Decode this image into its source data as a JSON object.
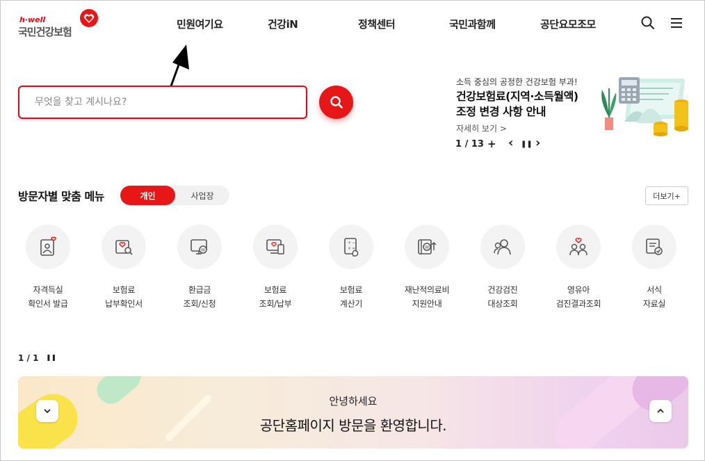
{
  "header": {
    "logo_small": "h·well",
    "logo_name": "국민건강보험",
    "nav": [
      "민원여기요",
      "건강iN",
      "정책센터",
      "국민과함께",
      "공단요모조모"
    ]
  },
  "search": {
    "placeholder": "무엇을 찾고 계시나요?"
  },
  "banner": {
    "subtitle": "소득 중심의 공정한 건강보험 부과!",
    "title_line1": "건강보험료(지역·소득월액)",
    "title_line2": "조정 변경 사항 안내",
    "more": "자세히 보기 >",
    "pager": "1 / 13",
    "plus": "+",
    "prev": "‹",
    "pause": "❚❚",
    "next": "›"
  },
  "menu": {
    "title": "방문자별 맞춤 메뉴",
    "tab_on": "개인",
    "tab_off": "사업장",
    "more": "더보기+",
    "items": [
      {
        "label": "자격득실\n확인서 발급",
        "icon": "certificate-heart-icon"
      },
      {
        "label": "보험료\n납부확인서",
        "icon": "document-search-icon"
      },
      {
        "label": "환급금\n조회/신청",
        "icon": "monitor-coin-icon"
      },
      {
        "label": "보험료\n조회/납부",
        "icon": "computer-receipt-icon"
      },
      {
        "label": "보험료\n계산기",
        "icon": "calculator-icon"
      },
      {
        "label": "재난적의료비\n지원안내",
        "icon": "wallet-coin-icon"
      },
      {
        "label": "건강검진\n대상조회",
        "icon": "people-search-icon"
      },
      {
        "label": "영유아\n검진결과조회",
        "icon": "family-heart-icon"
      },
      {
        "label": "서식\n자료실",
        "icon": "form-check-icon"
      }
    ],
    "pager": "1 / 1",
    "pause": "❚❚"
  },
  "welcome": {
    "line1": "안녕하세요",
    "line2": "공단홈페이지 방문을 환영합니다."
  },
  "colors": {
    "brand_red": "#e81717",
    "text_dark": "#222222"
  }
}
